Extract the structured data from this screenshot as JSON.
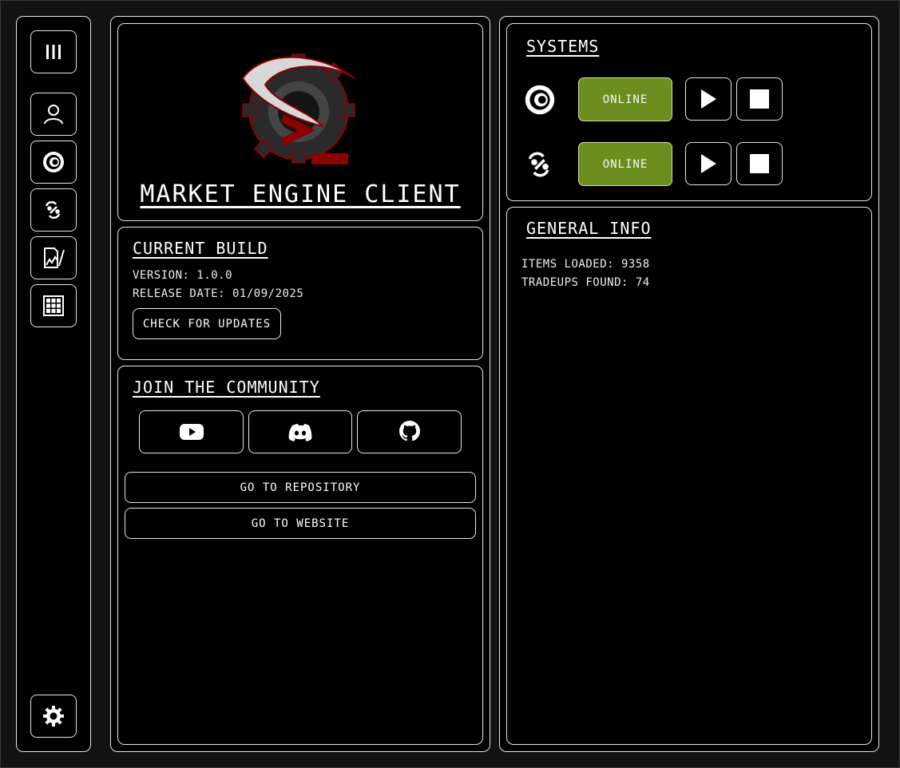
{
  "colors": {
    "online": "#6b8e1f",
    "border": "#e6e6e6",
    "logo_red": "#8b0000"
  },
  "sidebar": {
    "items": [
      {
        "name": "menu",
        "icon": "bars-icon"
      },
      {
        "name": "account",
        "icon": "user-icon"
      },
      {
        "name": "currency",
        "icon": "coin-icon"
      },
      {
        "name": "tradeups",
        "icon": "exchange-percent-icon"
      },
      {
        "name": "reports",
        "icon": "chart-file-icon"
      },
      {
        "name": "grid",
        "icon": "grid-icon"
      }
    ],
    "settings_icon": "gear-icon"
  },
  "header": {
    "title": "Market Engine Client"
  },
  "build": {
    "heading": "Current Build",
    "version": "Version: 1.0.0",
    "release": "Release Date: 01/09/2025",
    "update_label": "Check for updates"
  },
  "community": {
    "heading": "Join the Community",
    "icons": [
      "youtube-icon",
      "discord-icon",
      "github-icon"
    ],
    "repo_label": "Go to Repository",
    "website_label": "Go to Website"
  },
  "systems": {
    "heading": "Systems",
    "rows": [
      {
        "icon": "coin-icon",
        "status": "Online"
      },
      {
        "icon": "exchange-percent-icon",
        "status": "Online"
      }
    ]
  },
  "info": {
    "heading": "General Info",
    "items_loaded": "Items Loaded: 9358",
    "tradeups_found": "Tradeups Found: 74"
  }
}
